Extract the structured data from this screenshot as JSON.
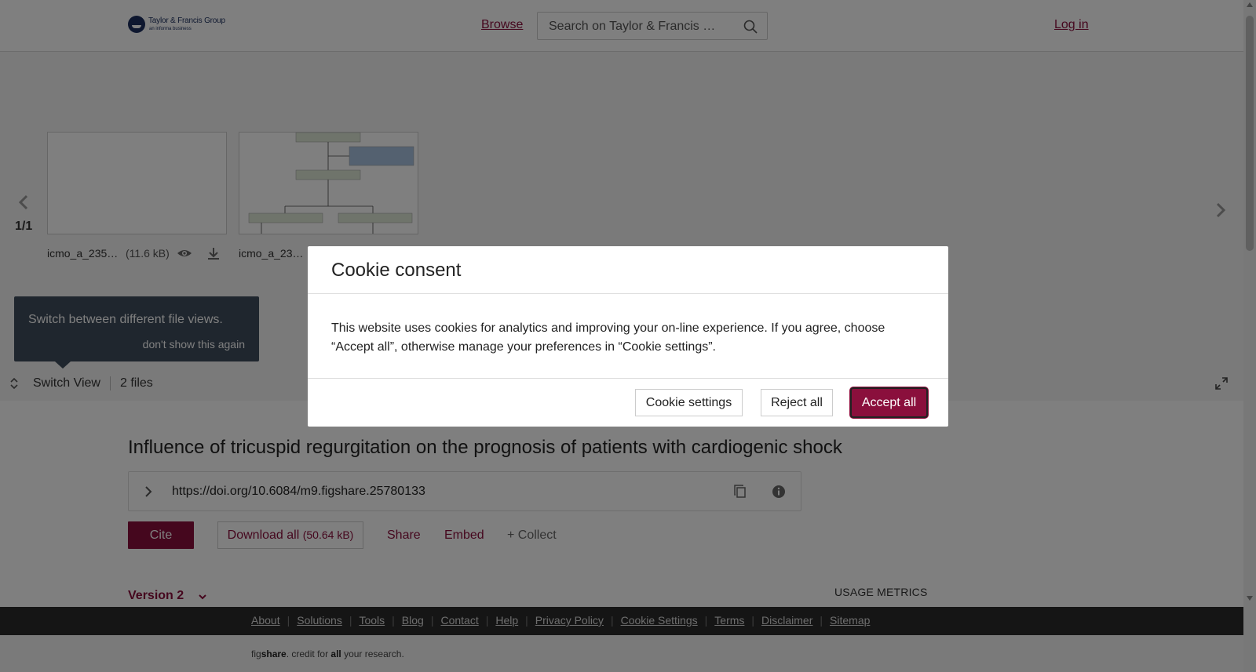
{
  "header": {
    "logo_main": "Taylor & Francis Group",
    "logo_sub": "an informa business",
    "browse": "Browse",
    "search_placeholder": "Search on Taylor & Francis …",
    "login": "Log in"
  },
  "viewer": {
    "pager": "1/1",
    "files": [
      {
        "name": "icmo_a_235…",
        "size": "(11.6 kB)"
      },
      {
        "name": "icmo_a_23…"
      }
    ],
    "tooltip_text": "Switch between different file views.",
    "tooltip_dismiss": "don't show this again",
    "switch_view": "Switch View",
    "files_count": "2 files"
  },
  "item": {
    "title": "Influence of tricuspid regurgitation on the prognosis of patients with cardiogenic shock",
    "doi": "https://doi.org/10.6084/m9.figshare.25780133",
    "cite": "Cite",
    "download_all": "Download all",
    "download_size": "(50.64 kB)",
    "share": "Share",
    "embed": "Embed",
    "collect": "+ Collect",
    "version": "Version 2",
    "usage_metrics": "USAGE METRICS"
  },
  "footer": {
    "links": [
      "About",
      "Solutions",
      "Tools",
      "Blog",
      "Contact",
      "Help",
      "Privacy Policy",
      "Cookie Settings",
      "Terms",
      "Disclaimer",
      "Sitemap"
    ],
    "credit_prefix": "fig",
    "credit_brand": "share",
    "credit_middle": ". credit for ",
    "credit_all": "all",
    "credit_suffix": " your research."
  },
  "cookie_modal": {
    "title": "Cookie consent",
    "body": "This website uses cookies for analytics and improving your on-line experience. If you agree, choose “Accept all”, otherwise manage your preferences in “Cookie settings”.",
    "settings": "Cookie settings",
    "reject": "Reject all",
    "accept": "Accept all"
  },
  "colors": {
    "accent": "#8a0f3c",
    "footer_bg": "#2b2b2b",
    "tooltip_bg": "#3f4d5c"
  }
}
